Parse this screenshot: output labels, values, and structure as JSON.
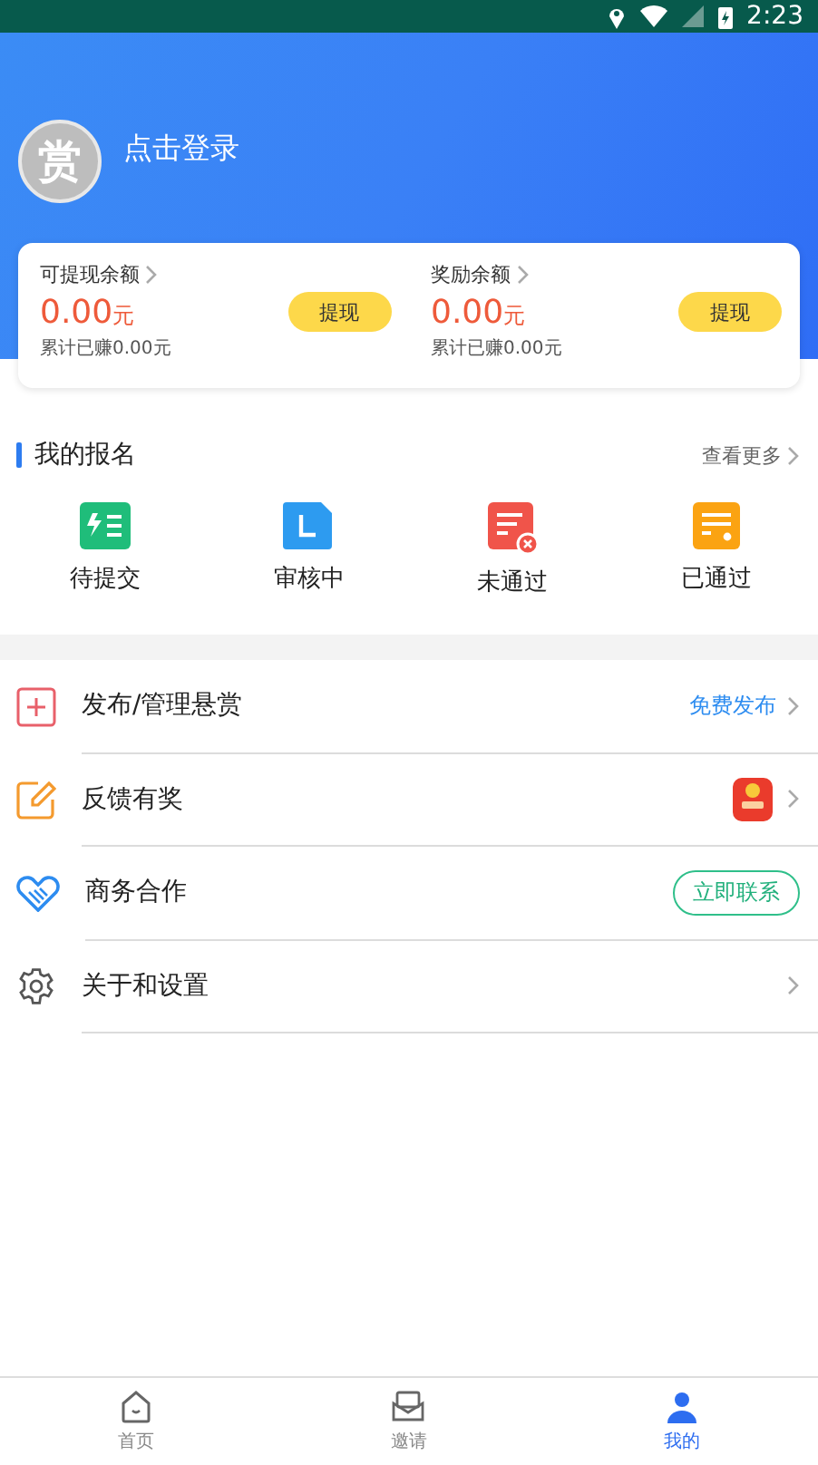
{
  "status_bar": {
    "time": "2:23"
  },
  "profile": {
    "avatar_text": "赏",
    "login_label": "点击登录"
  },
  "balances": [
    {
      "label": "可提现余额",
      "amount": "0.00",
      "unit": "元",
      "button": "提现",
      "total": "累计已赚0.00元"
    },
    {
      "label": "奖励余额",
      "amount": "0.00",
      "unit": "元",
      "button": "提现",
      "total": "累计已赚0.00元"
    }
  ],
  "signups": {
    "title": "我的报名",
    "more": "查看更多",
    "items": [
      {
        "kind": "pending",
        "label": "待提交"
      },
      {
        "kind": "review",
        "label": "审核中"
      },
      {
        "kind": "rejected",
        "label": "未通过"
      },
      {
        "kind": "passed",
        "label": "已通过"
      }
    ]
  },
  "menu": [
    {
      "kind": "publish",
      "label": "发布/管理悬赏",
      "extra": {
        "kind": "link",
        "text": "免费发布"
      },
      "chevron": true
    },
    {
      "kind": "feedback",
      "label": "反馈有奖",
      "extra": {
        "kind": "envelope"
      },
      "chevron": true
    },
    {
      "kind": "business",
      "label": "商务合作",
      "extra": {
        "kind": "pill",
        "text": "立即联系"
      },
      "chevron": false
    },
    {
      "kind": "settings",
      "label": "关于和设置",
      "chevron": true
    }
  ],
  "tabs": [
    {
      "kind": "home",
      "label": "首页",
      "selected": false
    },
    {
      "kind": "invite",
      "label": "邀请",
      "selected": false
    },
    {
      "kind": "mine",
      "label": "我的",
      "selected": true
    }
  ]
}
